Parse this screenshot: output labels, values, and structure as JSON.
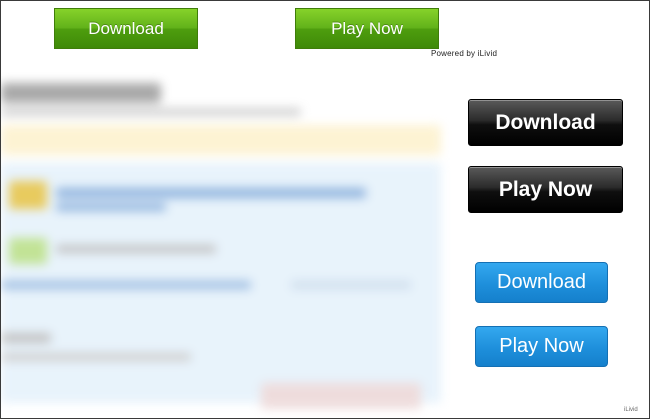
{
  "top_buttons": {
    "download_label": "Download",
    "play_label": "Play Now"
  },
  "powered_by": "Powered by iLivid",
  "black_buttons": {
    "download_label": "Download",
    "play_label": "Play Now"
  },
  "blue_buttons": {
    "download_label": "Download",
    "play_label": "Play Now"
  },
  "footer_mark": "iLivid",
  "colors": {
    "green_button": "#62b21a",
    "black_button": "#1a1a1a",
    "blue_button": "#1e8fdb",
    "blurred_highlight": "#fdf3d4",
    "blurred_panel": "#e3f1fb"
  }
}
